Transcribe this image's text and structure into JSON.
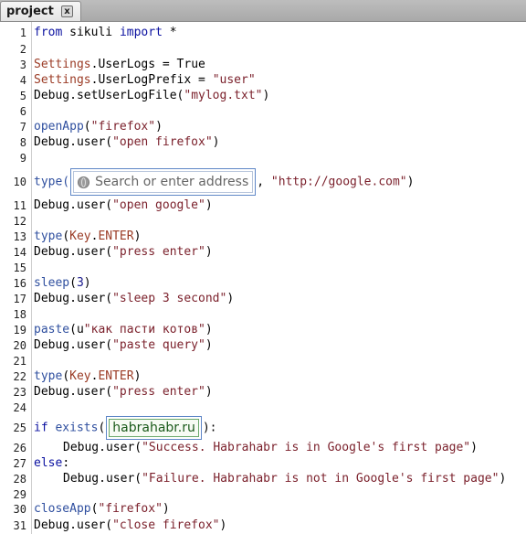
{
  "tab": {
    "label": "project",
    "close_glyph": "x"
  },
  "colors": {
    "keyword": "#0a10a0",
    "string": "#7a1f2a",
    "identifier": "#9b3b25",
    "function": "#2f4f9f"
  },
  "lines": [
    {
      "n": "1",
      "segs": [
        {
          "c": "kw",
          "t": "from"
        },
        {
          "c": "plain",
          "t": " sikuli "
        },
        {
          "c": "kw",
          "t": "import"
        },
        {
          "c": "plain",
          "t": " *"
        }
      ]
    },
    {
      "n": "2",
      "segs": []
    },
    {
      "n": "3",
      "segs": [
        {
          "c": "id",
          "t": "Settings"
        },
        {
          "c": "plain",
          "t": ".UserLogs = True"
        }
      ]
    },
    {
      "n": "4",
      "segs": [
        {
          "c": "id",
          "t": "Settings"
        },
        {
          "c": "plain",
          "t": ".UserLogPrefix = "
        },
        {
          "c": "str",
          "t": "\"user\""
        }
      ]
    },
    {
      "n": "5",
      "segs": [
        {
          "c": "plain",
          "t": "Debug.setUserLogFile("
        },
        {
          "c": "str",
          "t": "\"mylog.txt\""
        },
        {
          "c": "plain",
          "t": ")"
        }
      ]
    },
    {
      "n": "6",
      "segs": []
    },
    {
      "n": "7",
      "segs": [
        {
          "c": "fn",
          "t": "openApp"
        },
        {
          "c": "plain",
          "t": "("
        },
        {
          "c": "str",
          "t": "\"firefox\""
        },
        {
          "c": "plain",
          "t": ")"
        }
      ]
    },
    {
      "n": "8",
      "segs": [
        {
          "c": "plain",
          "t": "Debug.user("
        },
        {
          "c": "str",
          "t": "\"open firefox\""
        },
        {
          "c": "plain",
          "t": ")"
        }
      ]
    },
    {
      "n": "9",
      "segs": []
    },
    {
      "n": "10",
      "segs": []
    },
    {
      "n": "11",
      "segs": [
        {
          "c": "plain",
          "t": "Debug.user("
        },
        {
          "c": "str",
          "t": "\"open google\""
        },
        {
          "c": "plain",
          "t": ")"
        }
      ]
    },
    {
      "n": "12",
      "segs": []
    },
    {
      "n": "13",
      "segs": [
        {
          "c": "fn",
          "t": "type"
        },
        {
          "c": "plain",
          "t": "("
        },
        {
          "c": "id",
          "t": "Key"
        },
        {
          "c": "plain",
          "t": "."
        },
        {
          "c": "id",
          "t": "ENTER"
        },
        {
          "c": "plain",
          "t": ")"
        }
      ]
    },
    {
      "n": "14",
      "segs": [
        {
          "c": "plain",
          "t": "Debug.user("
        },
        {
          "c": "str",
          "t": "\"press enter\""
        },
        {
          "c": "plain",
          "t": ")"
        }
      ]
    },
    {
      "n": "15",
      "segs": []
    },
    {
      "n": "16",
      "segs": [
        {
          "c": "fn",
          "t": "sleep"
        },
        {
          "c": "plain",
          "t": "("
        },
        {
          "c": "num",
          "t": "3"
        },
        {
          "c": "plain",
          "t": ")"
        }
      ]
    },
    {
      "n": "17",
      "segs": [
        {
          "c": "plain",
          "t": "Debug.user("
        },
        {
          "c": "str",
          "t": "\"sleep 3 second\""
        },
        {
          "c": "plain",
          "t": ")"
        }
      ]
    },
    {
      "n": "18",
      "segs": []
    },
    {
      "n": "19",
      "segs": [
        {
          "c": "fn",
          "t": "paste"
        },
        {
          "c": "plain",
          "t": "(u"
        },
        {
          "c": "str",
          "t": "\"как пасти котов\""
        },
        {
          "c": "plain",
          "t": ")"
        }
      ]
    },
    {
      "n": "20",
      "segs": [
        {
          "c": "plain",
          "t": "Debug.user("
        },
        {
          "c": "str",
          "t": "\"paste query\""
        },
        {
          "c": "plain",
          "t": ")"
        }
      ]
    },
    {
      "n": "21",
      "segs": []
    },
    {
      "n": "22",
      "segs": [
        {
          "c": "fn",
          "t": "type"
        },
        {
          "c": "plain",
          "t": "("
        },
        {
          "c": "id",
          "t": "Key"
        },
        {
          "c": "plain",
          "t": "."
        },
        {
          "c": "id",
          "t": "ENTER"
        },
        {
          "c": "plain",
          "t": ")"
        }
      ]
    },
    {
      "n": "23",
      "segs": [
        {
          "c": "plain",
          "t": "Debug.user("
        },
        {
          "c": "str",
          "t": "\"press enter\""
        },
        {
          "c": "plain",
          "t": ")"
        }
      ]
    },
    {
      "n": "24",
      "segs": []
    },
    {
      "n": "25",
      "segs": []
    },
    {
      "n": "26",
      "indent": true,
      "segs": [
        {
          "c": "plain",
          "t": "Debug.user("
        },
        {
          "c": "str",
          "t": "\"Success. Habrahabr is in Google's first page\""
        },
        {
          "c": "plain",
          "t": ")"
        }
      ]
    },
    {
      "n": "27",
      "segs": [
        {
          "c": "kw",
          "t": "else"
        },
        {
          "c": "plain",
          "t": ":"
        }
      ]
    },
    {
      "n": "28",
      "indent": true,
      "segs": [
        {
          "c": "plain",
          "t": "Debug.user("
        },
        {
          "c": "str",
          "t": "\"Failure. Habrahabr is not in Google's first page\""
        },
        {
          "c": "plain",
          "t": ")"
        }
      ]
    },
    {
      "n": "29",
      "segs": []
    },
    {
      "n": "30",
      "segs": [
        {
          "c": "fn",
          "t": "closeApp"
        },
        {
          "c": "plain",
          "t": "("
        },
        {
          "c": "str",
          "t": "\"firefox\""
        },
        {
          "c": "plain",
          "t": ")"
        }
      ]
    },
    {
      "n": "31",
      "segs": [
        {
          "c": "plain",
          "t": "Debug.user("
        },
        {
          "c": "str",
          "t": "\"close firefox\""
        },
        {
          "c": "plain",
          "t": ")"
        }
      ]
    }
  ],
  "line10": {
    "prefix": "type(",
    "pattern_text": "Search or enter address",
    "suffix_sep": ", ",
    "url": "\"http://google.com\"",
    "close": ")"
  },
  "line25": {
    "if_kw": "if",
    "fn": "exists",
    "open": "(",
    "pattern_text": "habrahabr.ru",
    "close": "):"
  }
}
